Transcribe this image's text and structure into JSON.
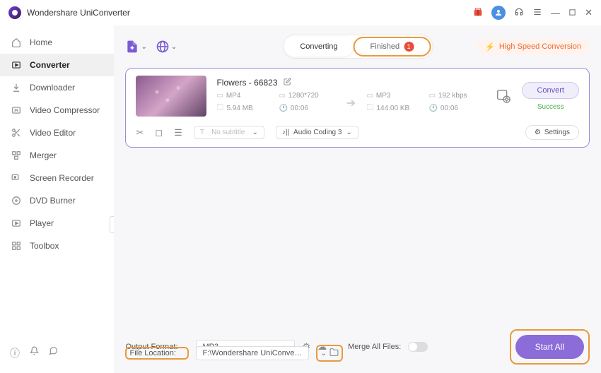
{
  "app": {
    "title": "Wondershare UniConverter"
  },
  "sidebar": {
    "items": [
      {
        "label": "Home"
      },
      {
        "label": "Converter"
      },
      {
        "label": "Downloader"
      },
      {
        "label": "Video Compressor"
      },
      {
        "label": "Video Editor"
      },
      {
        "label": "Merger"
      },
      {
        "label": "Screen Recorder"
      },
      {
        "label": "DVD Burner"
      },
      {
        "label": "Player"
      },
      {
        "label": "Toolbox"
      }
    ]
  },
  "tabs": {
    "converting": "Converting",
    "finished": "Finished",
    "finished_count": "1"
  },
  "hsc": {
    "label": "High Speed Conversion"
  },
  "file": {
    "name": "Flowers - 66823",
    "src": {
      "format": "MP4",
      "res": "1280*720",
      "size": "5.94 MB",
      "dur": "00:06"
    },
    "dst": {
      "format": "MP3",
      "bitrate": "192 kbps",
      "size": "144.00 KB",
      "dur": "00:06"
    },
    "subtitle_placeholder": "No subtitle",
    "audio_track": "Audio Coding 3",
    "settings_label": "Settings",
    "convert_label": "Convert",
    "status": "Success"
  },
  "footer": {
    "output_format_label": "Output Format:",
    "output_format_value": "MP3",
    "file_location_label": "File Location:",
    "file_location_value": "F:\\Wondershare UniConverter",
    "merge_label": "Merge All Files:",
    "start_all": "Start All"
  }
}
